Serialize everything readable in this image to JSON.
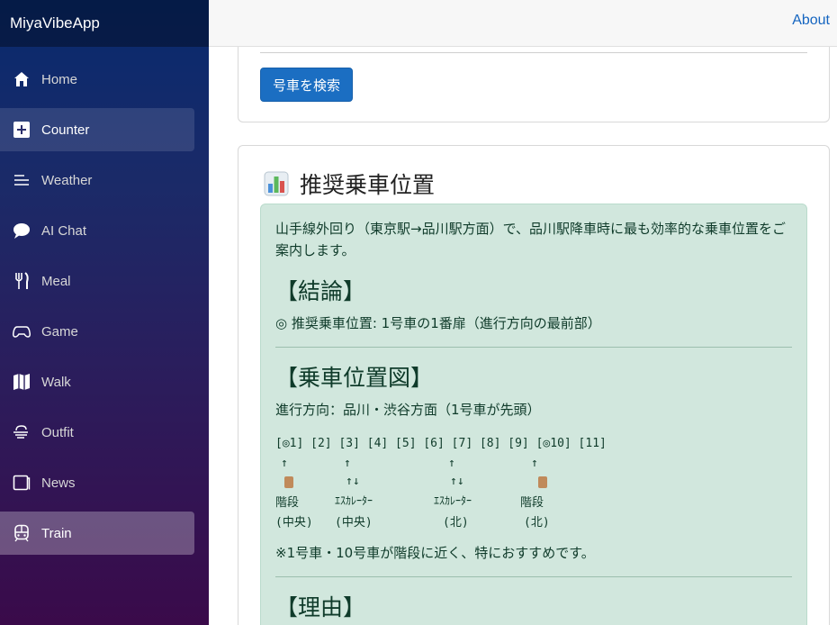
{
  "app": {
    "brand": "MiyaVibeApp"
  },
  "topbar": {
    "about": "About"
  },
  "sidebar": {
    "items": [
      {
        "label": "Home",
        "icon": "home-icon"
      },
      {
        "label": "Counter",
        "icon": "plus-square-icon"
      },
      {
        "label": "Weather",
        "icon": "list-icon"
      },
      {
        "label": "AI Chat",
        "icon": "chat-icon"
      },
      {
        "label": "Meal",
        "icon": "utensils-icon"
      },
      {
        "label": "Game",
        "icon": "gamepad-icon"
      },
      {
        "label": "Walk",
        "icon": "map-icon"
      },
      {
        "label": "Outfit",
        "icon": "wind-icon"
      },
      {
        "label": "News",
        "icon": "news-icon"
      },
      {
        "label": "Train",
        "icon": "train-icon"
      }
    ]
  },
  "search": {
    "button_label": "号車を検索"
  },
  "result": {
    "title": "推奨乗車位置",
    "intro": "山手線外回り（東京駅→品川駅方面）で、品川駅降車時に最も効率的な乗車位置をご案内します。",
    "conclusion_title": "【結論】",
    "conclusion_text": "◎ 推奨乗車位置: 1号車の1番扉（進行方向の最前部）",
    "map_title": "【乗車位置図】",
    "direction_text": "進行方向：品川・渋谷方面（1号車が先頭）",
    "car_row": "[◎1] [2] [3] [4] [5] [6] [7] [8] [9] [◎10] [11]",
    "markers": [
      {
        "arrow": "↑",
        "door": true,
        "label": "階段",
        "sub": "(中央)"
      },
      {
        "arrow": "↑",
        "door": false,
        "arrow2": "↑↓",
        "label": "ｴｽｶﾚｰﾀｰ",
        "sub": "(中央)"
      },
      {
        "arrow": "↑",
        "door": false,
        "arrow2": "↑↓",
        "label": "ｴｽｶﾚｰﾀｰ",
        "sub": "(北)"
      },
      {
        "arrow": "↑",
        "door": true,
        "label": "階段",
        "sub": "(北)"
      }
    ],
    "note": "※1号車・10号車が階段に近く、特におすすめです。",
    "reason_title": "【理由】"
  },
  "colors": {
    "accent": "#1b6ec2",
    "alert_bg": "#d1e7dd",
    "sidebar_top": "#082a6e",
    "sidebar_bottom": "#3a0a4a"
  }
}
